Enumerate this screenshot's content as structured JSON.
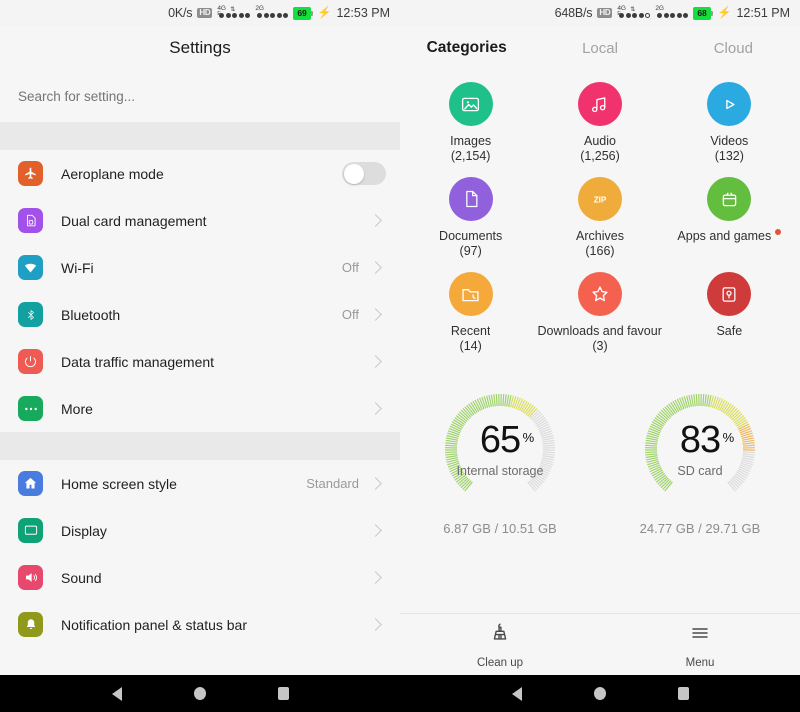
{
  "left": {
    "status_bar": {
      "net_speed": "0K/s",
      "hd_label": "HD",
      "sim1_gen": "4G",
      "sim1_sub": "E",
      "sim2_gen": "2G",
      "battery": "69",
      "time": "12:53 PM"
    },
    "title": "Settings",
    "search": {
      "placeholder": "Search for setting...",
      "value": ""
    },
    "groups": [
      {
        "items": [
          {
            "label": "Aeroplane mode",
            "icon": "aeroplane-icon",
            "color": "#e2602a",
            "control": "toggle",
            "toggle_on": false,
            "value": ""
          },
          {
            "label": "Dual card management",
            "icon": "sim-card-icon",
            "color": "#a252e8",
            "control": "chevron",
            "value": ""
          },
          {
            "label": "Wi-Fi",
            "icon": "wifi-icon",
            "color": "#1f9fc4",
            "control": "chevron",
            "value": "Off"
          },
          {
            "label": "Bluetooth",
            "icon": "bluetooth-icon",
            "color": "#13a0a0",
            "control": "chevron",
            "value": "Off"
          },
          {
            "label": "Data traffic management",
            "icon": "data-traffic-icon",
            "color": "#ef5a52",
            "control": "chevron",
            "value": ""
          },
          {
            "label": "More",
            "icon": "more-dots-icon",
            "color": "#17a95c",
            "control": "chevron",
            "value": ""
          }
        ]
      },
      {
        "items": [
          {
            "label": "Home screen style",
            "icon": "home-icon",
            "color": "#4a7ce0",
            "control": "chevron",
            "value": "Standard"
          },
          {
            "label": "Display",
            "icon": "display-icon",
            "color": "#10a277",
            "control": "chevron",
            "value": ""
          },
          {
            "label": "Sound",
            "icon": "sound-icon",
            "color": "#e8486e",
            "control": "chevron",
            "value": ""
          },
          {
            "label": "Notification panel & status bar",
            "icon": "bell-icon",
            "color": "#8f9a1b",
            "control": "chevron",
            "value": ""
          }
        ]
      }
    ]
  },
  "right": {
    "status_bar": {
      "net_speed": "648B/s",
      "hd_label": "HD",
      "sim1_gen": "4G",
      "sim1_sub": "E",
      "sim2_gen": "2G",
      "battery": "68",
      "time": "12:51 PM"
    },
    "tabs": [
      {
        "label": "Categories",
        "active": true
      },
      {
        "label": "Local",
        "active": false
      },
      {
        "label": "Cloud",
        "active": false
      }
    ],
    "categories": [
      [
        {
          "name": "Images",
          "count": "(2,154)",
          "icon": "image-icon",
          "color": "#1fc08a",
          "badge": false
        },
        {
          "name": "Audio",
          "count": "(1,256)",
          "icon": "music-note-icon",
          "color": "#f0326f",
          "badge": false
        },
        {
          "name": "Videos",
          "count": "(132)",
          "icon": "play-icon",
          "color": "#2aaae0",
          "badge": false
        }
      ],
      [
        {
          "name": "Documents",
          "count": "(97)",
          "icon": "document-icon",
          "color": "#9161dd",
          "badge": false
        },
        {
          "name": "Archives",
          "count": "(166)",
          "icon": "zip-icon",
          "color": "#f0ac3b",
          "badge": false,
          "icon_text": "ZIP"
        },
        {
          "name": "Apps and games",
          "count": "",
          "icon": "apps-icon",
          "color": "#63bd3e",
          "badge": true
        }
      ],
      [
        {
          "name": "Recent",
          "count": "(14)",
          "icon": "recent-folder-icon",
          "color": "#f4a93a",
          "badge": false
        },
        {
          "name": "Downloads and favouri...",
          "count": "(3)",
          "icon": "star-icon",
          "color": "#f4624f",
          "badge": false
        },
        {
          "name": "Safe",
          "count": "",
          "icon": "safe-lock-icon",
          "color": "#cf3b3b",
          "badge": false
        }
      ]
    ],
    "gauges": [
      {
        "percent": "65",
        "percent_value": 65,
        "unit": "%",
        "label": "Internal storage",
        "size": "6.87 GB / 10.51 GB"
      },
      {
        "percent": "83",
        "percent_value": 83,
        "unit": "%",
        "label": "SD card",
        "size": "24.77 GB / 29.71 GB"
      }
    ],
    "toolbar": [
      {
        "label": "Clean up",
        "icon": "broom-icon"
      },
      {
        "label": "Menu",
        "icon": "hamburger-menu-icon"
      }
    ]
  },
  "navbar": {
    "back": "back-button",
    "home": "home-button",
    "recents": "recents-button"
  }
}
